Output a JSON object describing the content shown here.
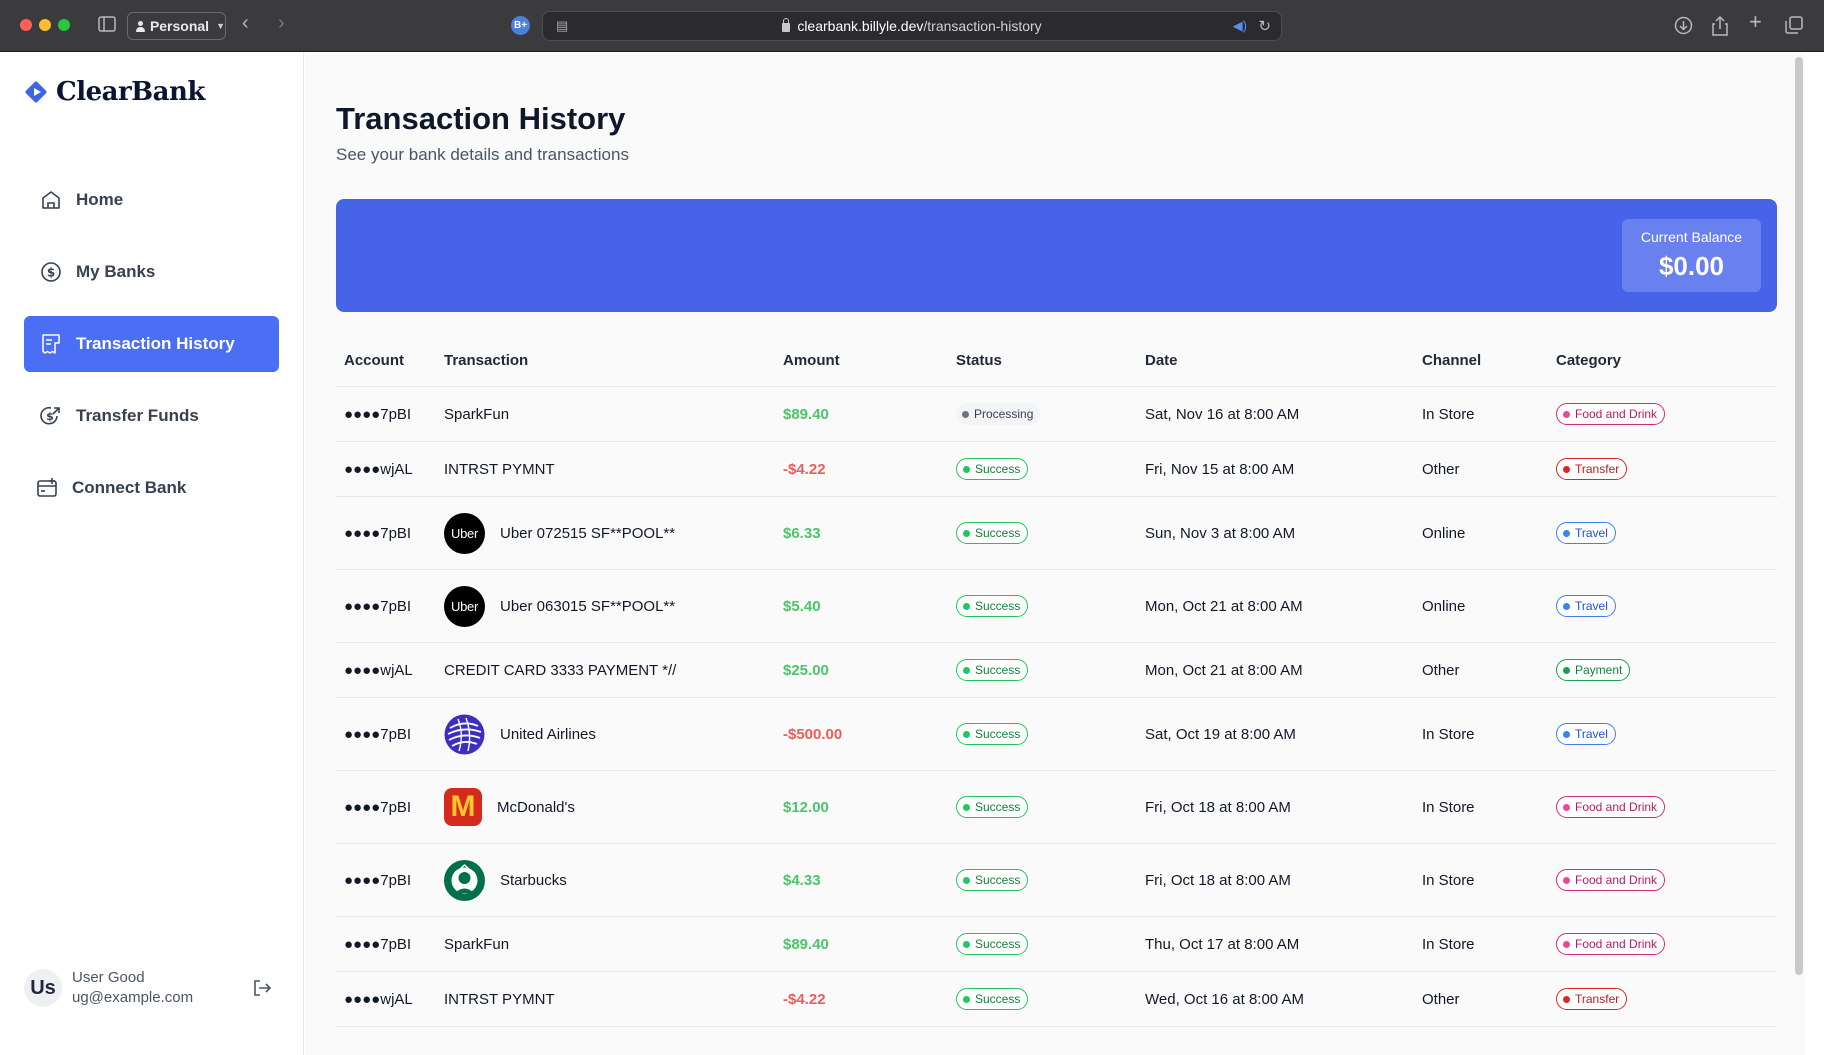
{
  "browser": {
    "profile_label": "Personal",
    "url_domain": "clearbank.billyle.dev",
    "url_path": "/transaction-history",
    "extension_badge": "B+"
  },
  "brand": {
    "name": "ClearBank",
    "color": "#3f62e6"
  },
  "sidebar": {
    "items": [
      {
        "label": "Home",
        "icon": "home-icon",
        "active": false
      },
      {
        "label": "My Banks",
        "icon": "dollar-circle-icon",
        "active": false
      },
      {
        "label": "Transaction History",
        "icon": "receipt-icon",
        "active": true
      },
      {
        "label": "Transfer Funds",
        "icon": "money-send-icon",
        "active": false
      },
      {
        "label": "Connect Bank",
        "icon": "connect-bank-icon",
        "active": false
      }
    ],
    "user": {
      "initials": "Us",
      "name": "User Good",
      "email": "ug@example.com"
    }
  },
  "page": {
    "title": "Transaction History",
    "subtitle": "See your bank details and transactions",
    "balance_label": "Current Balance",
    "balance_value": "$0.00",
    "accent_color": "#4763e8"
  },
  "table": {
    "headers": [
      "Account",
      "Transaction",
      "Amount",
      "Status",
      "Date",
      "Channel",
      "Category"
    ],
    "rows": [
      {
        "account": "●●●●7pBI",
        "name": "SparkFun",
        "logo": "",
        "amount": "$89.40",
        "sign": "pos",
        "status": "Processing",
        "date": "Sat, Nov 16 at 8:00 AM",
        "channel": "In Store",
        "category": "Food and Drink"
      },
      {
        "account": "●●●●wjAL",
        "name": "INTRST PYMNT",
        "logo": "",
        "amount": "-$4.22",
        "sign": "neg",
        "status": "Success",
        "date": "Fri, Nov 15 at 8:00 AM",
        "channel": "Other",
        "category": "Transfer"
      },
      {
        "account": "●●●●7pBI",
        "name": "Uber 072515 SF**POOL**",
        "logo": "uber",
        "amount": "$6.33",
        "sign": "pos",
        "status": "Success",
        "date": "Sun, Nov 3 at 8:00 AM",
        "channel": "Online",
        "category": "Travel"
      },
      {
        "account": "●●●●7pBI",
        "name": "Uber 063015 SF**POOL**",
        "logo": "uber",
        "amount": "$5.40",
        "sign": "pos",
        "status": "Success",
        "date": "Mon, Oct 21 at 8:00 AM",
        "channel": "Online",
        "category": "Travel"
      },
      {
        "account": "●●●●wjAL",
        "name": "CREDIT CARD 3333 PAYMENT *//",
        "logo": "",
        "amount": "$25.00",
        "sign": "pos",
        "status": "Success",
        "date": "Mon, Oct 21 at 8:00 AM",
        "channel": "Other",
        "category": "Payment"
      },
      {
        "account": "●●●●7pBI",
        "name": "United Airlines",
        "logo": "united",
        "amount": "-$500.00",
        "sign": "neg",
        "status": "Success",
        "date": "Sat, Oct 19 at 8:00 AM",
        "channel": "In Store",
        "category": "Travel"
      },
      {
        "account": "●●●●7pBI",
        "name": "McDonald's",
        "logo": "mcdonalds",
        "amount": "$12.00",
        "sign": "pos",
        "status": "Success",
        "date": "Fri, Oct 18 at 8:00 AM",
        "channel": "In Store",
        "category": "Food and Drink"
      },
      {
        "account": "●●●●7pBI",
        "name": "Starbucks",
        "logo": "starbucks",
        "amount": "$4.33",
        "sign": "pos",
        "status": "Success",
        "date": "Fri, Oct 18 at 8:00 AM",
        "channel": "In Store",
        "category": "Food and Drink"
      },
      {
        "account": "●●●●7pBI",
        "name": "SparkFun",
        "logo": "",
        "amount": "$89.40",
        "sign": "pos",
        "status": "Success",
        "date": "Thu, Oct 17 at 8:00 AM",
        "channel": "In Store",
        "category": "Food and Drink"
      },
      {
        "account": "●●●●wjAL",
        "name": "INTRST PYMNT",
        "logo": "",
        "amount": "-$4.22",
        "sign": "neg",
        "status": "Success",
        "date": "Wed, Oct 16 at 8:00 AM",
        "channel": "Other",
        "category": "Transfer"
      }
    ],
    "logo_labels": {
      "uber": "Uber",
      "mcdonalds": "M"
    }
  }
}
